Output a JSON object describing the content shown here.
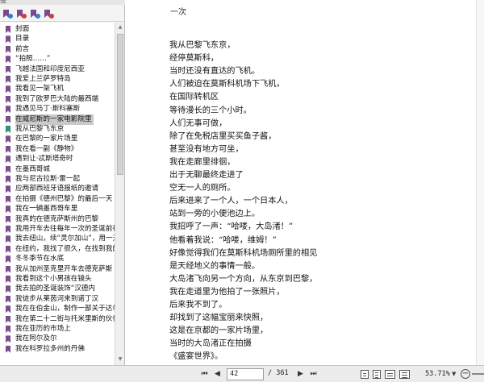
{
  "sidebar": {
    "pane_title": "签",
    "toolbar": [
      {
        "icon": "bookmark-expand-icon",
        "dot_color": "#2f7fd0"
      },
      {
        "icon": "bookmark-new-icon",
        "dot_color": "#d03b3b"
      },
      {
        "icon": "bookmark-expand-icon",
        "dot_color": "#2f7fd0"
      },
      {
        "icon": "bookmark-options-icon",
        "dot_color": "#d03b3b"
      }
    ],
    "bookmarks": [
      "封面",
      "目录",
      "前言",
      "“拍照……”",
      "飞越法国和印度尼西亚",
      "我爱上兰萨罗特岛",
      "我看见一架飞机",
      "我到了欧罗巴大陆的最西端",
      "我遇见马丁·斯科塞斯",
      "在威尼斯的一家电影院里",
      "我从巴黎飞东京",
      "在巴黎的一家片场里",
      "我在看一副《静物》",
      "遇到让·忒斯塔奇时",
      "在墨西哥城",
      "我与尼古拉斯·雷一起",
      "应两部西班牙语报纸的邀请",
      "在拍摄《德州巴黎》的最后一天",
      "我在一辆墨西哥车里",
      "我真的在德克萨斯州的巴黎",
      "我用开车去往每年一次的圣诞前夜",
      "我去纽山，续“灵尔加山”，用一天",
      "在纽约，我找了很久，在找到我的",
      "冬冬季节在水底",
      "我从加州圣克里开车去德克萨斯",
      "我看到这个小男孩在镜头",
      "我去拍的圣诞装饰“汉德内",
      "我徒步从莱茵河来到诺丁汉",
      "我在在伯金山，制作一部关于达尔",
      "我在第二十二街与托米里斯的伙伴",
      "我在亚历的市场上",
      "我在阿尔及尔",
      "我在科罗拉多州的丹佛"
    ],
    "selected_index": 9,
    "current_index": 10
  },
  "document": {
    "chapter_tail": "一次",
    "lines": [
      "我从巴黎飞东京，",
      "经停莫斯科，",
      "当时还没有直达的飞机。",
      "人们被迫在莫斯科机场下飞机，",
      "在国际转机区",
      "等待漫长的三个小时。",
      "人们无事可做，",
      "除了在免税店里买买鱼子酱，",
      "甚至没有地方可坐，",
      "我在走廊里徘徊，",
      "出于无聊最终走进了",
      "空无一人的厕所。",
      "后来进来了一个人，一个日本人，",
      "站到一旁的小便池边上。",
      "我招呼了一声：“哈喽，大岛渚！”",
      "他看着我说：“哈喽，维姆！”",
      "好像觉得我们在莫斯科机场厕所里的相见",
      "是天经地义的事情一般。",
      "大岛渚飞向另一个方向，从东京到巴黎，",
      "我在走道里为他拍了一张照片，",
      "后来我不到了。",
      "却找到了这幅宝丽来快照，",
      "这是在京都的一家片场里，",
      "当时的大岛渚正在拍摄",
      "《盛宴世界》。"
    ]
  },
  "statusbar": {
    "current_page": "42",
    "page_total": "/ 361",
    "zoom": "53.71%",
    "nav_icons": [
      "first-page-icon",
      "prev-page-icon",
      "next-page-icon",
      "last-page-icon"
    ],
    "view_icons": [
      "single-page-view-icon",
      "continuous-view-icon",
      "facing-view-icon",
      "continuous-facing-view-icon"
    ]
  }
}
